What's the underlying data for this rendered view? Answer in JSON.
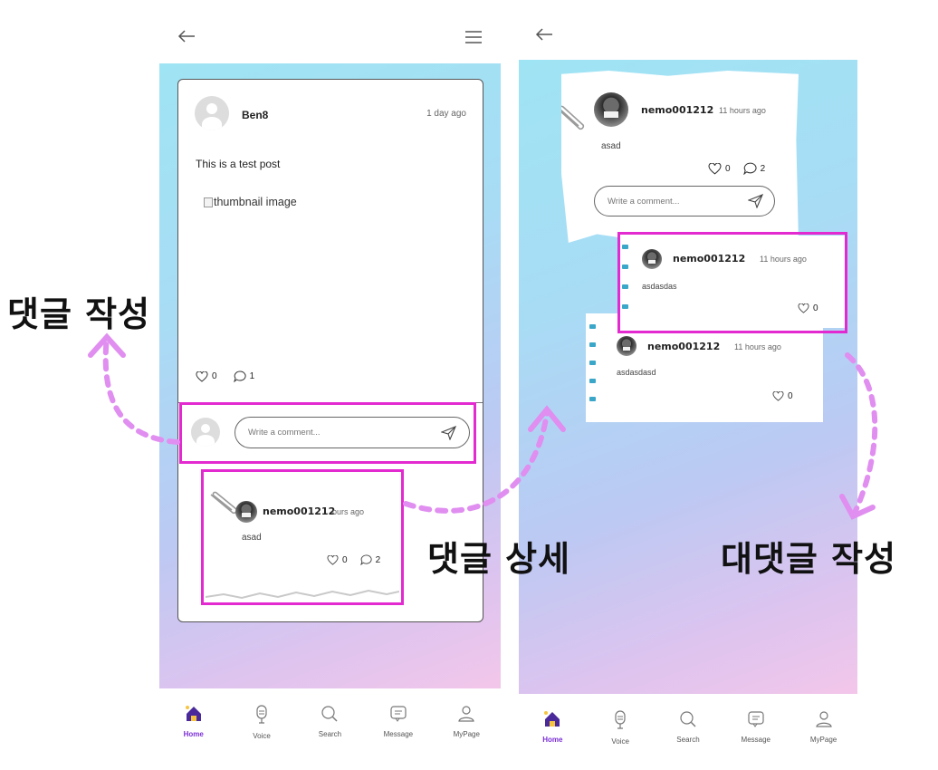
{
  "left_screen": {
    "post": {
      "author": "Ben8",
      "time": "1 day ago",
      "text": "This is a test post",
      "image_alt": "thumbnail image",
      "likes": "0",
      "comments": "1"
    },
    "comment_box": {
      "placeholder": "Write a comment..."
    },
    "comment": {
      "user": "nemo001212",
      "time": "ours ago",
      "text": "asad",
      "likes": "0",
      "replies": "2"
    }
  },
  "right_screen": {
    "comment": {
      "user": "nemo001212",
      "time": "11 hours ago",
      "text": "asad",
      "likes": "0",
      "replies": "2"
    },
    "reply_box": {
      "placeholder": "Write a comment..."
    },
    "replies": [
      {
        "user": "nemo001212",
        "time": "11 hours ago",
        "text": "asdasdas",
        "likes": "0"
      },
      {
        "user": "nemo001212",
        "time": "11 hours ago",
        "text": "asdasdasd",
        "likes": "0"
      }
    ]
  },
  "bottom_nav": [
    {
      "label": "Home",
      "icon": "home-icon",
      "active": true
    },
    {
      "label": "Voice",
      "icon": "microphone-icon",
      "active": false
    },
    {
      "label": "Search",
      "icon": "search-icon",
      "active": false
    },
    {
      "label": "Message",
      "icon": "message-icon",
      "active": false
    },
    {
      "label": "MyPage",
      "icon": "user-icon",
      "active": false
    }
  ],
  "annotations": {
    "write_comment": "댓글 작성",
    "comment_detail": "댓글 상세",
    "write_reply": "대댓글 작성"
  },
  "colors": {
    "highlight": "#e22ad0",
    "accent": "#7b2fd6",
    "arrow": "#e08ef0",
    "gradient_top": "#9fe4f4",
    "gradient_bottom": "#f3c6ea"
  }
}
